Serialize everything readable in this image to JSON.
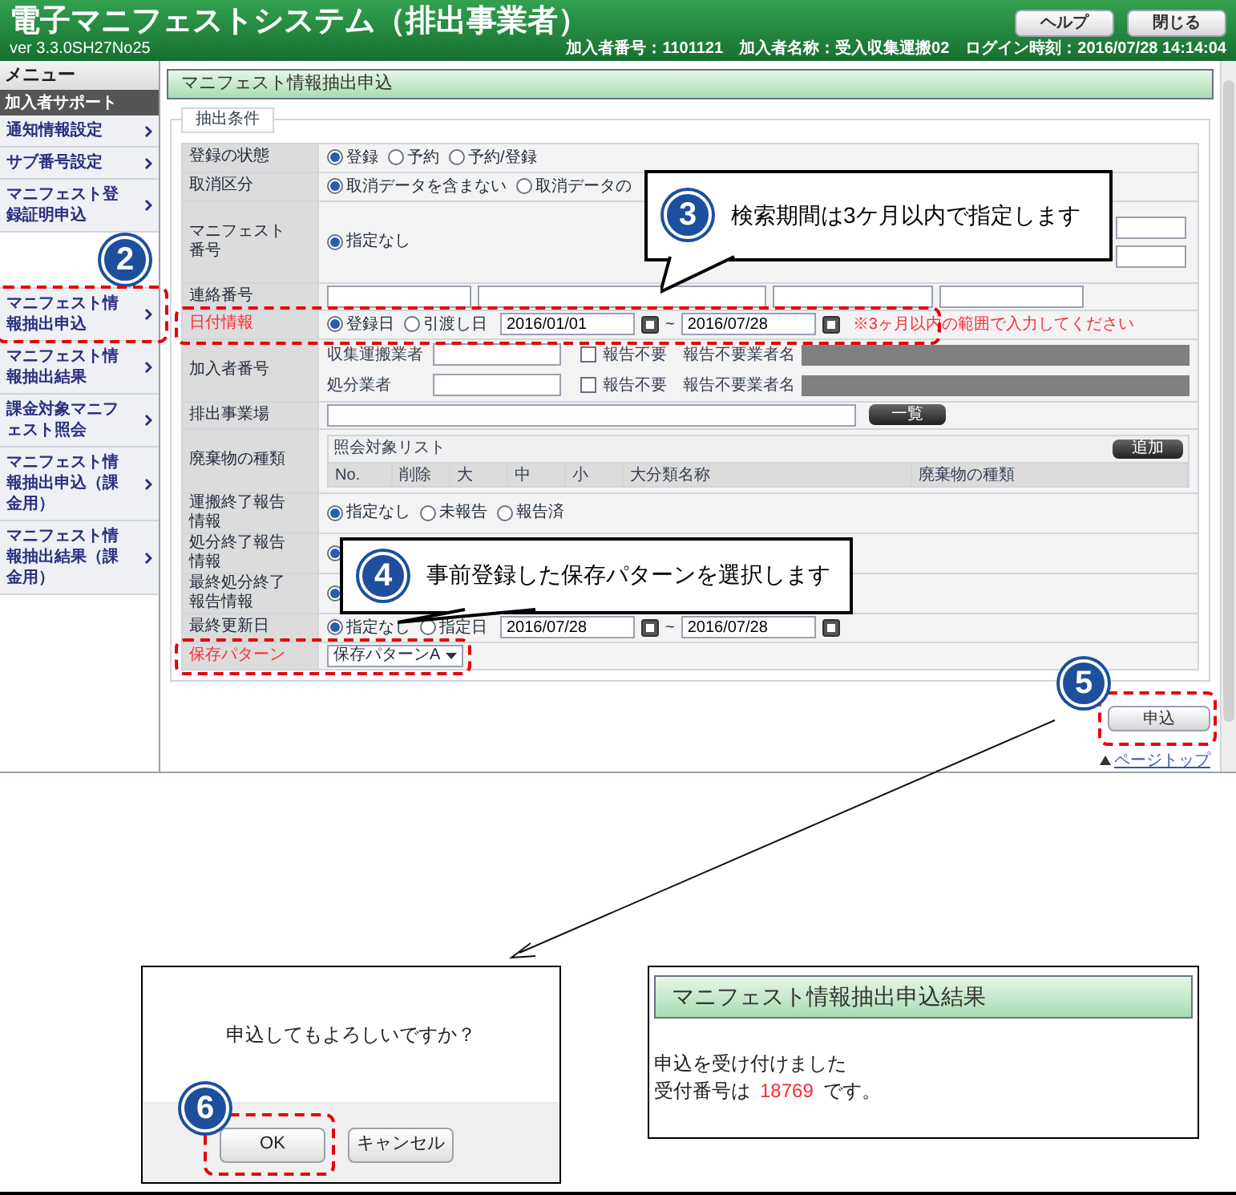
{
  "header": {
    "title": "電子マニフェストシステム（排出事業者）",
    "version": "ver 3.3.0SH27No25",
    "buttons": [
      "ヘルプ",
      "閉じる"
    ],
    "info": [
      "加入者番号：1101121",
      "加入者名称：受入収集運搬02",
      "ログイン時刻：2016/07/28 14:14:04"
    ]
  },
  "sidebar": {
    "title": "メニュー",
    "section": "加入者サポート",
    "items": [
      {
        "label": "通知情報設定",
        "highlighted": false
      },
      {
        "label": "サブ番号設定",
        "highlighted": false
      },
      {
        "label": "マニフェスト登録証明申込",
        "highlighted": false
      },
      {
        "label": "マニフェスト情報抽出申込",
        "highlighted": true,
        "step": "2"
      },
      {
        "label": "マニフェスト情報抽出結果",
        "highlighted": false
      },
      {
        "label": "課金対象マニフェスト照会",
        "highlighted": false
      },
      {
        "label": "マニフェスト情報抽出申込（課金用）",
        "highlighted": false
      },
      {
        "label": "マニフェスト情報抽出結果（課金用）",
        "highlighted": false
      }
    ]
  },
  "main": {
    "title": "マニフェスト情報抽出申込",
    "legend": "抽出条件",
    "rows": [
      {
        "kind": "radios",
        "label": "登録の状態",
        "emphasized": false,
        "highlighted": false,
        "options": [
          {
            "label": "登録",
            "selected": true
          },
          {
            "label": "予約",
            "selected": false
          },
          {
            "label": "予約/登録",
            "selected": false
          }
        ]
      },
      {
        "kind": "radios",
        "label": "取消区分",
        "emphasized": false,
        "highlighted": false,
        "options": [
          {
            "label": "取消データを含まない",
            "selected": true
          },
          {
            "label": "取消データの",
            "selected": false
          }
        ],
        "callout": {
          "step": "3",
          "text": "検索期間は3ケ月以内で指定します"
        }
      },
      {
        "kind": "manifest",
        "label": "マニフェスト番号",
        "emphasized": false,
        "highlighted": false,
        "options": [
          {
            "label": "指定なし",
            "selected": true
          }
        ]
      },
      {
        "kind": "inputs",
        "label": "連絡番号",
        "emphasized": false,
        "highlighted": false
      },
      {
        "kind": "dates",
        "label": "日付情報",
        "emphasized": true,
        "highlighted": true,
        "options": [
          {
            "label": "登録日",
            "selected": true
          },
          {
            "label": "引渡し日",
            "selected": false
          }
        ],
        "from": "2016/01/01",
        "separator": "~",
        "to": "2016/07/28",
        "note": "※3ヶ月以内の範囲で入力してください"
      },
      {
        "kind": "members",
        "label": "加入者番号",
        "emphasized": false,
        "highlighted": false,
        "lines": [
          {
            "label": "収集運搬業者",
            "checkbox": "報告不要",
            "checked": false,
            "name_label": "報告不要業者名"
          },
          {
            "label": "処分業者",
            "checkbox": "報告不要",
            "checked": false,
            "name_label": "報告不要業者名"
          }
        ]
      },
      {
        "kind": "search",
        "label": "排出事業場",
        "emphasized": false,
        "highlighted": false,
        "button": "一覧"
      },
      {
        "kind": "list",
        "label": "廃棄物の種類",
        "emphasized": false,
        "highlighted": false,
        "list_title": "照会対象リスト",
        "button": "追加",
        "columns": [
          "No.",
          "削除",
          "大",
          "中",
          "小",
          "大分類名称",
          "廃棄物の種類"
        ]
      },
      {
        "kind": "radios",
        "label": "運搬終了報告情報",
        "emphasized": false,
        "highlighted": false,
        "options": [
          {
            "label": "指定なし",
            "selected": true
          },
          {
            "label": "未報告",
            "selected": false
          },
          {
            "label": "報告済",
            "selected": false
          }
        ]
      },
      {
        "kind": "radios",
        "label": "処分終了報告情報",
        "emphasized": false,
        "highlighted": false,
        "options": [
          {
            "selected": true
          }
        ],
        "callout": {
          "step": "4",
          "text": "事前登録した保存パターンを選択します"
        }
      },
      {
        "kind": "radios",
        "label": "最終処分終了報告情報",
        "emphasized": false,
        "highlighted": false,
        "options": [
          {
            "selected": true
          }
        ]
      },
      {
        "kind": "dates",
        "label": "最終更新日",
        "emphasized": false,
        "highlighted": false,
        "options": [
          {
            "label": "指定なし",
            "selected": true
          },
          {
            "label": "指定日",
            "selected": false
          }
        ],
        "from": "2016/07/28",
        "separator": "~",
        "to": "2016/07/28"
      },
      {
        "kind": "select",
        "label": "保存パターン",
        "emphasized": true,
        "highlighted": true,
        "value": "保存パターンA"
      }
    ],
    "submit": {
      "label": "申込",
      "highlighted": true,
      "step": "5"
    },
    "page_top": "ページトップ"
  },
  "confirm": {
    "message": "申込してもよろしいですか？",
    "buttons": [
      {
        "label": "OK",
        "highlighted": true,
        "step": "6"
      },
      {
        "label": "キャンセル",
        "highlighted": false
      }
    ]
  },
  "result": {
    "title": "マニフェスト情報抽出申込結果",
    "message": "申込を受け付けました",
    "number_prefix": "受付番号は",
    "number": "18769",
    "number_suffix": "です。"
  }
}
